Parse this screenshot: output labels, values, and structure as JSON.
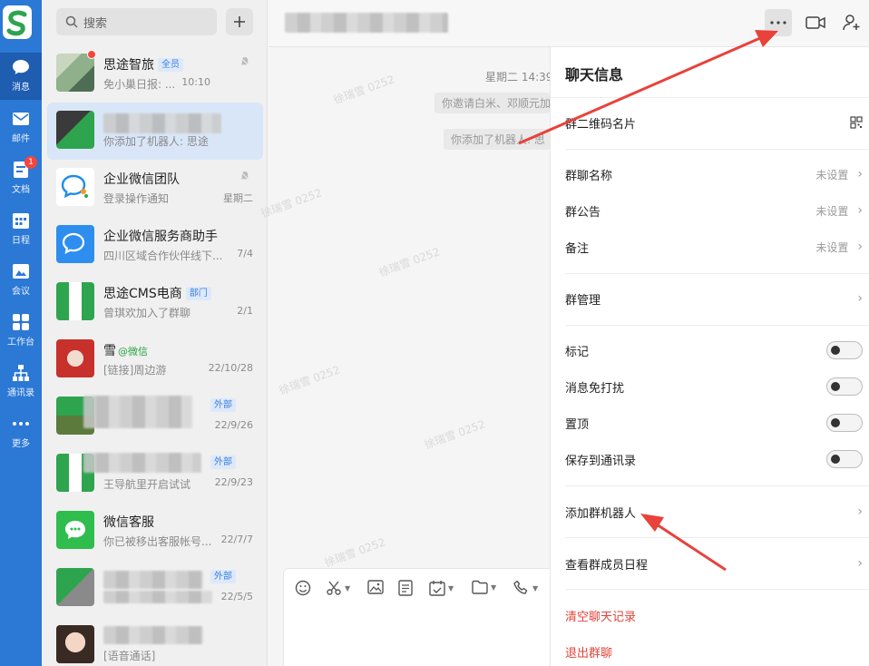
{
  "sidebar": {
    "items": [
      {
        "label": "消息",
        "icon": "chat-bubble-icon",
        "active": true
      },
      {
        "label": "邮件",
        "icon": "mail-icon"
      },
      {
        "label": "文档",
        "icon": "document-icon",
        "badge": "1"
      },
      {
        "label": "日程",
        "icon": "calendar-icon"
      },
      {
        "label": "会议",
        "icon": "meeting-icon"
      },
      {
        "label": "工作台",
        "icon": "workbench-grid-icon"
      },
      {
        "label": "通讯录",
        "icon": "org-chart-icon"
      },
      {
        "label": "更多",
        "icon": "more-dots-icon"
      }
    ]
  },
  "search": {
    "placeholder": "搜索"
  },
  "conversations": [
    {
      "name": "思途智旅",
      "tag": "全员",
      "preview": "免小巢日报: ...",
      "time": "10:10",
      "muted": true,
      "unread_dot": true
    },
    {
      "name": "",
      "preview": "你添加了机器人: 思途",
      "time": "",
      "selected": true
    },
    {
      "name": "企业微信团队",
      "preview": "登录操作通知",
      "time": "星期二",
      "muted": true
    },
    {
      "name": "企业微信服务商助手",
      "preview": "四川区域合作伙伴线下...",
      "time": "7/4"
    },
    {
      "name": "思途CMS电商",
      "tag": "部门",
      "preview": "曾琪欢加入了群聊",
      "time": "2/1"
    },
    {
      "name": "雪",
      "tag_wx": "@微信",
      "preview": "[链接]周边游",
      "time": "22/10/28"
    },
    {
      "name": "",
      "tag": "外部",
      "preview": "...",
      "time": "22/9/26"
    },
    {
      "name": "",
      "tag": "外部",
      "preview": "王导航里开启试试",
      "time": "22/9/23"
    },
    {
      "name": "微信客服",
      "preview": "你已被移出客服帐号...",
      "time": "22/7/7"
    },
    {
      "name": "",
      "tag": "外部",
      "preview": "",
      "time": "22/5/5"
    },
    {
      "name": "",
      "preview": "[语音通话]",
      "time": ""
    }
  ],
  "chat": {
    "timestamp": "星期二 14:39",
    "system_messages": [
      "你邀请白米、邓顺元加",
      "你添加了机器人: 思"
    ],
    "watermark": "徐瑞雪 0252"
  },
  "info_panel": {
    "title": "聊天信息",
    "qr_row": "群二维码名片",
    "rows_a": [
      {
        "label": "群聊名称",
        "value": "未设置"
      },
      {
        "label": "群公告",
        "value": "未设置"
      },
      {
        "label": "备注",
        "value": "未设置"
      }
    ],
    "manage": "群管理",
    "toggles": [
      {
        "label": "标记"
      },
      {
        "label": "消息免打扰"
      },
      {
        "label": "置顶"
      },
      {
        "label": "保存到通讯录"
      }
    ],
    "add_robot": "添加群机器人",
    "member_schedule": "查看群成员日程",
    "clear_history": "清空聊天记录",
    "quit_group": "退出群聊"
  },
  "colors": {
    "rail": "#2b78d5",
    "accent": "#3a7fdb",
    "danger": "#e0443a",
    "arrow": "#e8423b"
  }
}
